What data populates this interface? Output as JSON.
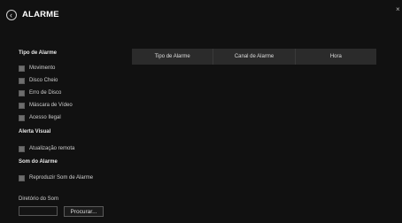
{
  "header": {
    "title": "ALARME",
    "close": "×"
  },
  "alarm_type": {
    "title": "Tipo de Alarme",
    "items": [
      "Movimento",
      "Disco Cheio",
      "Erro de Disco",
      "Máscara de Vídeo",
      "Acesso Ilegal"
    ]
  },
  "visual_alert": {
    "title": "Alerta Visual",
    "items": [
      "Atualização remota"
    ]
  },
  "alarm_sound": {
    "title": "Som do Alarme",
    "items": [
      "Reproduzir Som de Alarme"
    ]
  },
  "sound_dir": {
    "label": "Diretório do Som",
    "value": "",
    "browse_label": "Procurar..."
  },
  "table": {
    "columns": [
      "Tipo de Alarme",
      "Canal de Alarme",
      "Hora"
    ]
  },
  "colors": {
    "background": "#111111",
    "checkbox": "#6e6e6e",
    "table_header": "#2b2b2b"
  }
}
